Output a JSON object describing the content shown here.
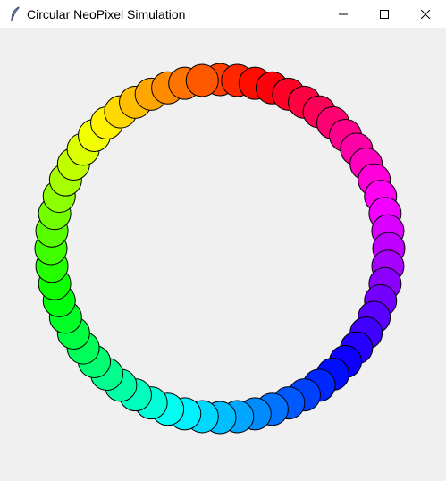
{
  "window": {
    "title": "Circular NeoPixel Simulation",
    "app_icon": "feather-icon",
    "controls": [
      "minimize-icon",
      "maximize-icon",
      "close-icon"
    ]
  },
  "canvas": {
    "background": "#f0f0f0",
    "led_outline_color": "#000000",
    "led_count": 60,
    "hue_at_top_deg": 15,
    "hue_direction": "counterclockwise-increasing"
  }
}
